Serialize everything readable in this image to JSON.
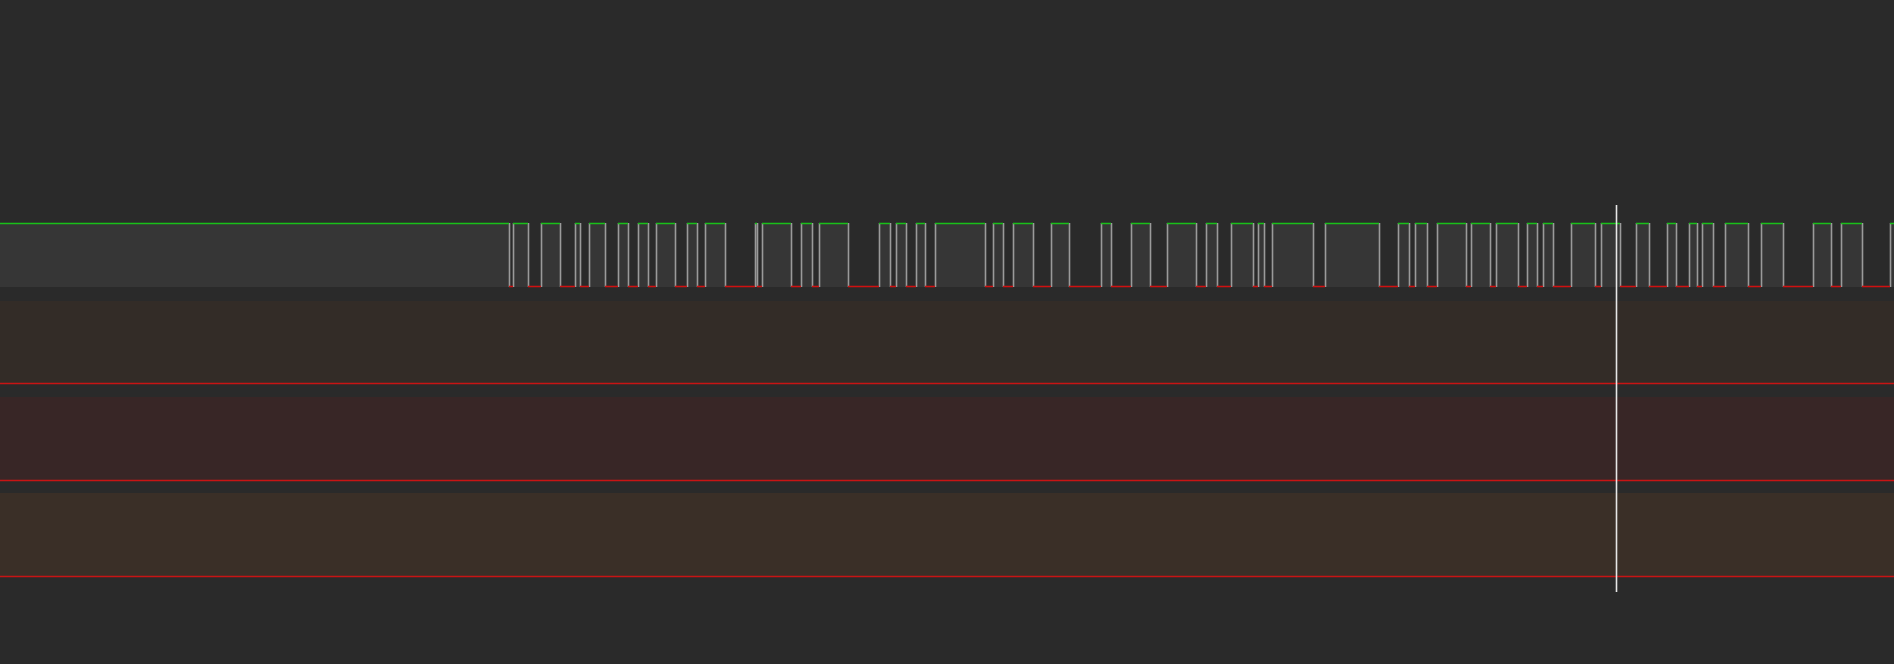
{
  "colors": {
    "background": "#2a2a2a",
    "digital_lane": "#363636",
    "digital_high": "#19c019",
    "digital_low": "#d01010",
    "digital_edge": "#9a9a9a",
    "analog_lane_1": "#332c27",
    "analog_lane_2": "#382626",
    "analog_lane_3": "#3a2f27",
    "analog_trace": "#c81414",
    "cursor": "#e6e6e6"
  },
  "digital_signal": {
    "initial_level": 1,
    "transitions": [
      509,
      513,
      528,
      541,
      560,
      575,
      580,
      589,
      605,
      618,
      628,
      638,
      648,
      656,
      675,
      687,
      697,
      705,
      725,
      755,
      757,
      762,
      791,
      801,
      812,
      819,
      848,
      879,
      890,
      896,
      906,
      916,
      925,
      935,
      985,
      993,
      1003,
      1013,
      1033,
      1051,
      1069,
      1101,
      1111,
      1131,
      1150,
      1167,
      1196,
      1206,
      1217,
      1231,
      1253,
      1258,
      1264,
      1272,
      1313,
      1325,
      1379,
      1398,
      1409,
      1415,
      1427,
      1437,
      1466,
      1471,
      1490,
      1496,
      1518,
      1527,
      1537,
      1543,
      1553,
      1571,
      1595,
      1601,
      1620,
      1636,
      1649,
      1667,
      1676,
      1689,
      1697,
      1702,
      1713,
      1725,
      1748,
      1761,
      1783,
      1813,
      1831,
      1841,
      1862,
      1890
    ]
  },
  "analog_lanes": [
    {
      "level": 0.0
    },
    {
      "level": 0.0
    },
    {
      "level": 0.0
    }
  ],
  "cursor": {
    "position": 1616
  }
}
